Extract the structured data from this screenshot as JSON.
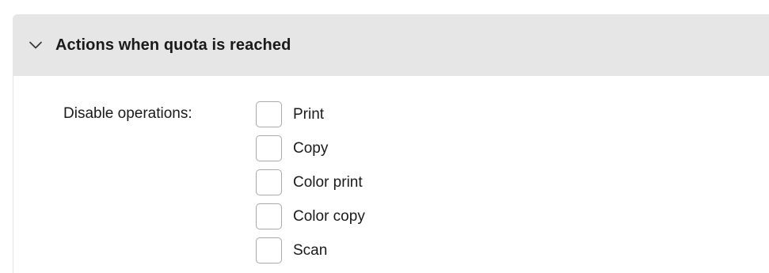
{
  "section": {
    "title": "Actions when quota is reached",
    "expanded": true,
    "chevron_icon": "chevron-down-icon"
  },
  "disable_operations": {
    "label": "Disable operations:",
    "options": [
      {
        "label": "Print",
        "checked": false
      },
      {
        "label": "Copy",
        "checked": false
      },
      {
        "label": "Color print",
        "checked": false
      },
      {
        "label": "Color copy",
        "checked": false
      },
      {
        "label": "Scan",
        "checked": false
      }
    ]
  }
}
